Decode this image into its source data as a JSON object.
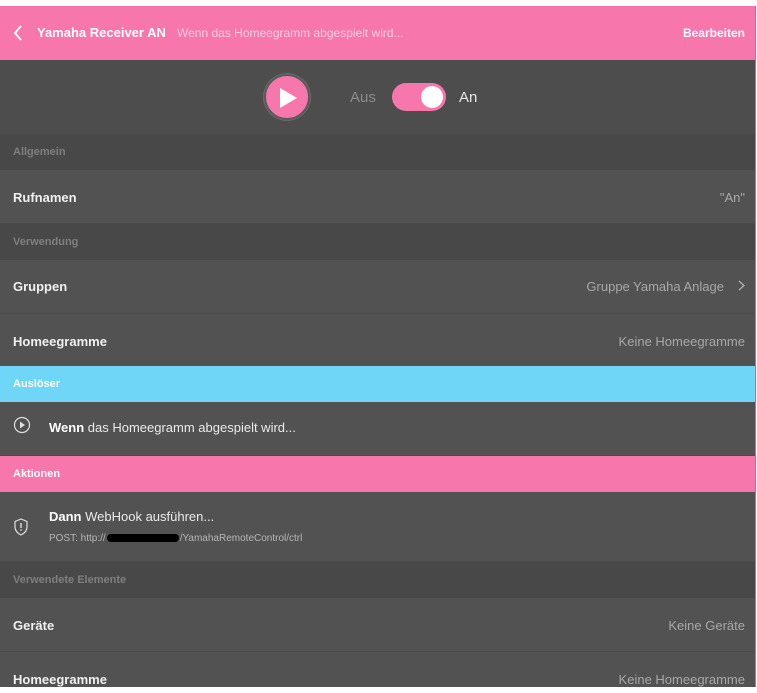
{
  "header": {
    "title": "Yamaha Receiver AN",
    "subtitle": "Wenn das Homeegramm abgespielt wird...",
    "edit_label": "Bearbeiten"
  },
  "controls": {
    "off_label": "Aus",
    "on_label": "An",
    "toggle_state": "on"
  },
  "sections": {
    "general": "Allgemein",
    "usage": "Verwendung",
    "trigger": "Auslöser",
    "actions": "Aktionen",
    "used_elements": "Verwendete Elemente"
  },
  "general": {
    "call_names_label": "Rufnamen",
    "call_names_value": "\"An\""
  },
  "usage": {
    "groups_label": "Gruppen",
    "groups_value": "Gruppe Yamaha Anlage",
    "homeegrams_label": "Homeegramme",
    "homeegrams_value": "Keine Homeegramme"
  },
  "trigger": {
    "keyword": "Wenn",
    "text": " das Homeegramm abgespielt wird..."
  },
  "action": {
    "keyword": "Dann",
    "text": " WebHook ausführen...",
    "detail_prefix": "POST: http://",
    "detail_suffix": "/YamahaRemoteControl/ctrl"
  },
  "used_elements": {
    "devices_label": "Geräte",
    "devices_value": "Keine Geräte",
    "homeegrams_label": "Homeegramme",
    "homeegrams_value": "Keine Homeegramme"
  },
  "colors": {
    "accent_pink": "#f777ad",
    "trigger_blue": "#6fd6f7",
    "background": "#525252"
  }
}
